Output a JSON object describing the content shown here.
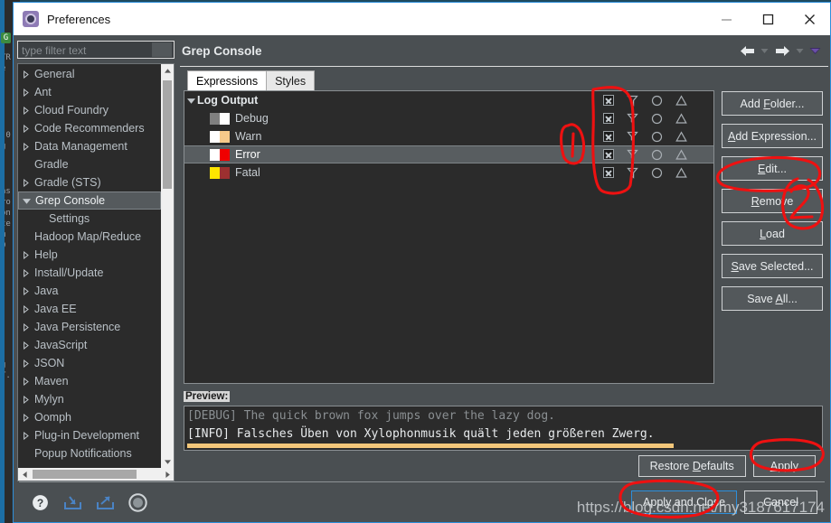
{
  "window": {
    "title": "Preferences",
    "title_icon": "gear-icon",
    "minimize_label": "—",
    "maximize_label": "☐",
    "close_label": "✕"
  },
  "sidebar": {
    "filter": {
      "placeholder": "type filter text",
      "value": ""
    },
    "items": [
      {
        "label": "General",
        "expandable": true,
        "indent": 0,
        "selected": false
      },
      {
        "label": "Ant",
        "expandable": true,
        "indent": 0,
        "selected": false
      },
      {
        "label": "Cloud Foundry",
        "expandable": true,
        "indent": 0,
        "selected": false
      },
      {
        "label": "Code Recommenders",
        "expandable": true,
        "indent": 0,
        "selected": false
      },
      {
        "label": "Data Management",
        "expandable": true,
        "indent": 0,
        "selected": false
      },
      {
        "label": "Gradle",
        "expandable": false,
        "indent": 0,
        "selected": false
      },
      {
        "label": "Gradle (STS)",
        "expandable": true,
        "indent": 0,
        "selected": false
      },
      {
        "label": "Grep Console",
        "expandable": true,
        "expanded": true,
        "indent": 0,
        "selected": true
      },
      {
        "label": "Settings",
        "expandable": false,
        "indent": 1,
        "selected": false
      },
      {
        "label": "Hadoop Map/Reduce",
        "expandable": false,
        "indent": 0,
        "selected": false
      },
      {
        "label": "Help",
        "expandable": true,
        "indent": 0,
        "selected": false
      },
      {
        "label": "Install/Update",
        "expandable": true,
        "indent": 0,
        "selected": false
      },
      {
        "label": "Java",
        "expandable": true,
        "indent": 0,
        "selected": false
      },
      {
        "label": "Java EE",
        "expandable": true,
        "indent": 0,
        "selected": false
      },
      {
        "label": "Java Persistence",
        "expandable": true,
        "indent": 0,
        "selected": false
      },
      {
        "label": "JavaScript",
        "expandable": true,
        "indent": 0,
        "selected": false
      },
      {
        "label": "JSON",
        "expandable": true,
        "indent": 0,
        "selected": false
      },
      {
        "label": "Maven",
        "expandable": true,
        "indent": 0,
        "selected": false
      },
      {
        "label": "Mylyn",
        "expandable": true,
        "indent": 0,
        "selected": false
      },
      {
        "label": "Oomph",
        "expandable": true,
        "indent": 0,
        "selected": false
      },
      {
        "label": "Plug-in Development",
        "expandable": true,
        "indent": 0,
        "selected": false
      },
      {
        "label": "Popup Notifications",
        "expandable": false,
        "indent": 0,
        "selected": false
      }
    ]
  },
  "page": {
    "title": "Grep Console",
    "nav": {
      "back_icon": "arrow-left-icon",
      "back_menu_icon": "chevron-down-icon",
      "forward_icon": "arrow-right-icon",
      "forward_menu_icon": "chevron-down-icon",
      "overflow_icon": "chevron-down-icon"
    },
    "tabs": [
      {
        "label": "Expressions",
        "active": true
      },
      {
        "label": "Styles",
        "active": false
      }
    ]
  },
  "expressions": {
    "columns": {
      "checkbox_icon": "checkbox-checked-icon",
      "filter_icon": "funnel-icon",
      "circle_icon": "circle-icon",
      "triangle_icon": "triangle-icon"
    },
    "rows": [
      {
        "label": "Log Output",
        "type": "group",
        "selected": false,
        "swatch_left": "",
        "swatch_right": "",
        "checkbox": true,
        "funnel": true,
        "circle": true,
        "triangle": true
      },
      {
        "label": "Debug",
        "type": "item",
        "selected": false,
        "swatch_left": "#808080",
        "swatch_right": "#ffffff",
        "checkbox": true,
        "funnel": true,
        "circle": true,
        "triangle": true
      },
      {
        "label": "Warn",
        "type": "item",
        "selected": false,
        "swatch_left": "#ffffff",
        "swatch_right": "#f6c98a",
        "checkbox": true,
        "funnel": true,
        "circle": true,
        "triangle": true
      },
      {
        "label": "Error",
        "type": "item",
        "selected": true,
        "swatch_left": "#ffffff",
        "swatch_right": "#f00000",
        "checkbox": true,
        "funnel": true,
        "circle": true,
        "triangle": true
      },
      {
        "label": "Fatal",
        "type": "item",
        "selected": false,
        "swatch_left": "#ffe500",
        "swatch_right": "#9c3030",
        "checkbox": true,
        "funnel": true,
        "circle": true,
        "triangle": true
      }
    ]
  },
  "side_buttons": [
    {
      "label": "Add Folder...",
      "mnemonic": "F"
    },
    {
      "label": "Add Expression...",
      "mnemonic": "A"
    },
    {
      "label": "Edit...",
      "mnemonic": "E"
    },
    {
      "label": "Remove",
      "mnemonic": "R"
    },
    {
      "label": "Load",
      "mnemonic": "L"
    },
    {
      "label": "Save Selected...",
      "mnemonic": "S"
    },
    {
      "label": "Save All...",
      "mnemonic": "A"
    }
  ],
  "preview": {
    "label": "Preview:",
    "line_debug": "[DEBUG] The quick brown fox jumps over the lazy dog.",
    "line_info": "[INFO] Falsches Üben von Xylophonmusik quält jeden größeren Zwerg.",
    "highlight_color": "#f3c77a"
  },
  "footer": {
    "restore_defaults": "Restore Defaults",
    "apply": "Apply",
    "apply_and_close": "Apply and Close",
    "cancel": "Cancel"
  },
  "bottom_icons": [
    {
      "name": "help-icon"
    },
    {
      "name": "import-icon"
    },
    {
      "name": "export-icon"
    },
    {
      "name": "settings-circle-icon"
    }
  ],
  "watermark": {
    "text": "https://blog.csdn.net/my3187617174"
  },
  "annotations": {
    "marker_one": "1",
    "marker_two": "2",
    "color": "#ee1111",
    "shapes": [
      "circle-around-checkbox-column",
      "circle-marker-1",
      "circle-around-edit-button",
      "circle-marker-2",
      "circle-around-apply-button",
      "circle-around-apply-and-close-button"
    ]
  },
  "desktop_background": {
    "lines": [
      "c",
      "G",
      "",
      "",
      "TR",
      "e",
      "",
      "",
      "",
      ".0",
      "g",
      "",
      "",
      "as",
      "ro",
      "on",
      "te",
      "m",
      "0",
      "",
      "",
      "g",
      "T."
    ]
  },
  "colors": {
    "accent": "#2d8fdb",
    "dialog_bg": "#4a4f52",
    "tree_bg": "#2b2b2b",
    "selected_row": "#585d60",
    "annotation_red": "#ee1111"
  }
}
